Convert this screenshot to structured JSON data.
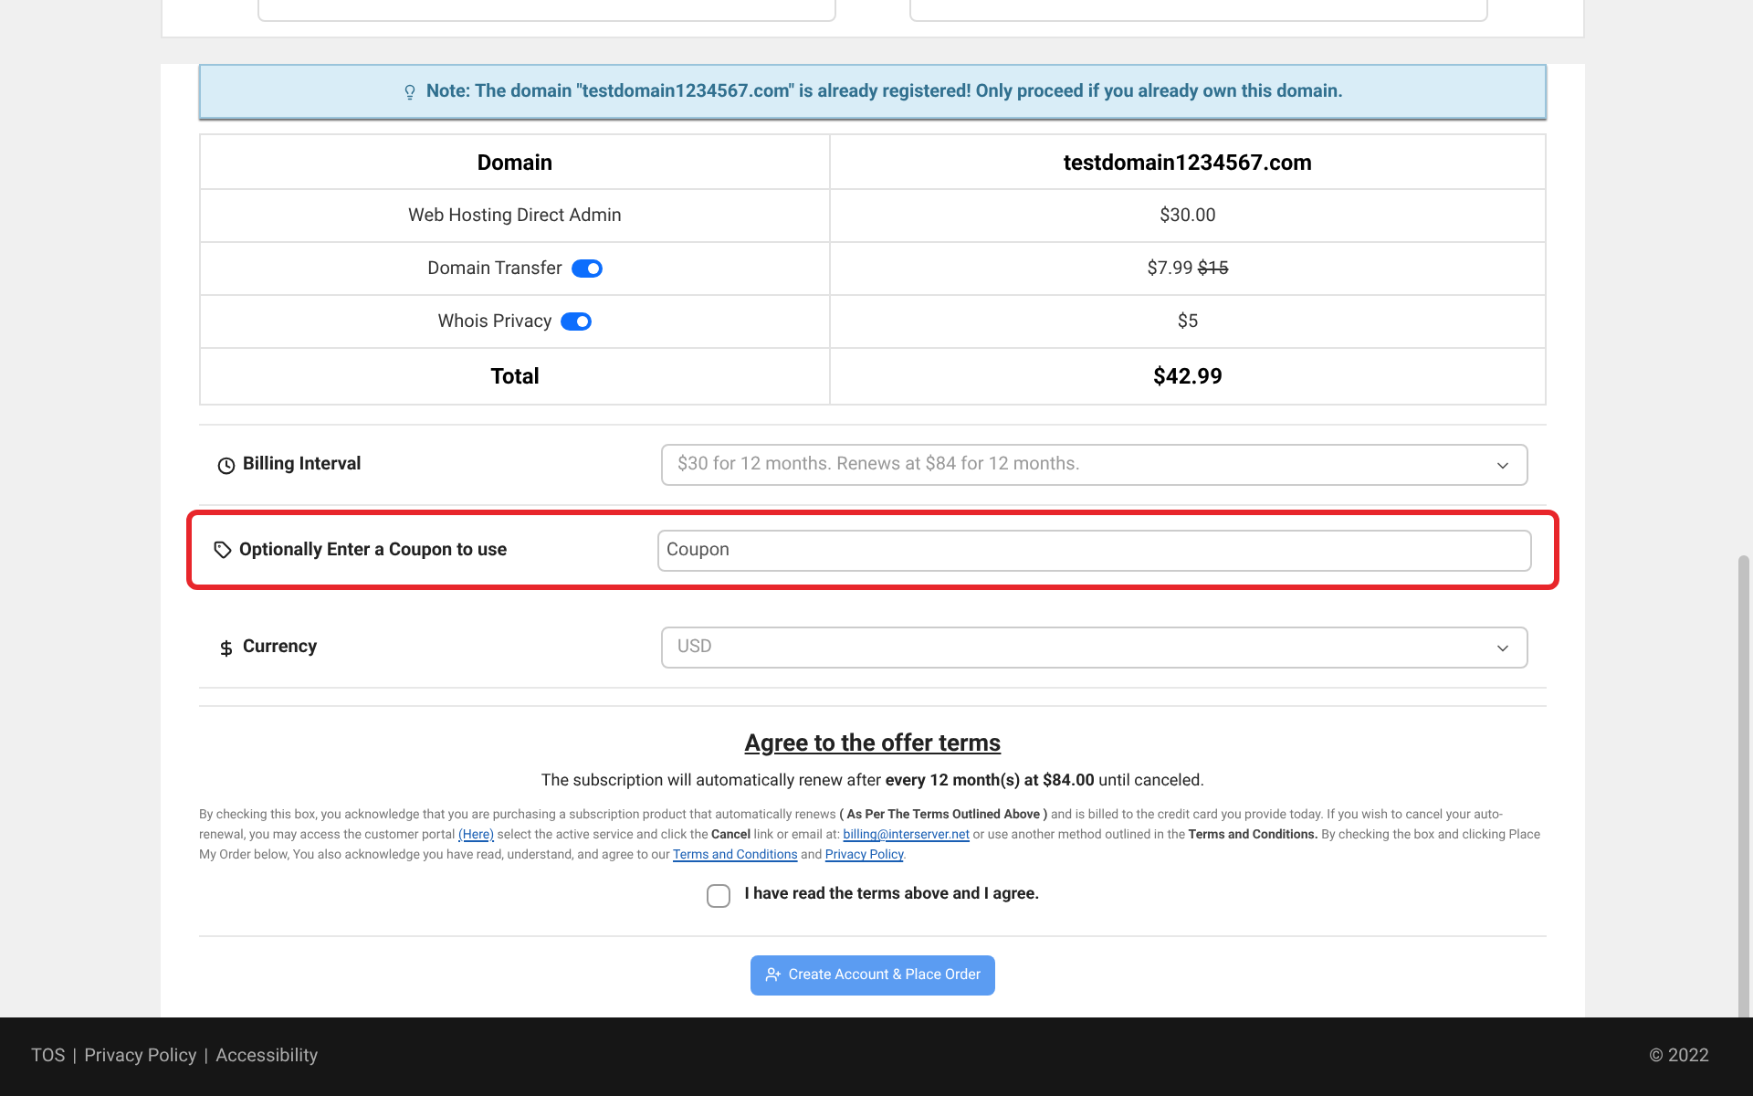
{
  "note": {
    "label": "Note:",
    "text": "The domain \"testdomain1234567.com\" is already registered! Only proceed if you already own this domain."
  },
  "summary": {
    "header": [
      "Domain",
      "testdomain1234567.com"
    ],
    "rows": [
      {
        "label": "Web Hosting Direct Admin",
        "price": "$30.00"
      },
      {
        "label": "Domain Transfer",
        "toggle": {
          "on": true
        },
        "price": "$7.99",
        "old_price": "$15"
      },
      {
        "label": "Whois Privacy",
        "toggle": {
          "on": true
        },
        "price": "$5"
      }
    ],
    "total": [
      "Total",
      "$42.99"
    ]
  },
  "options": [
    {
      "kind": "select",
      "label": "Billing Interval",
      "value": "$30 for 12 months. Renews at $84 for 12 months.",
      "highlighted": false
    },
    {
      "kind": "input",
      "label": "Optionally Enter a Coupon to use",
      "placeholder": "Coupon",
      "highlighted": true
    },
    {
      "kind": "select",
      "label": "Currency",
      "value": "USD",
      "highlighted": false
    }
  ],
  "terms": {
    "title": "Agree to the offer terms",
    "renewal": "The subscription will automatically renew after **every 12 month(s) at $84.00** until canceled.",
    "paragraph": [
      {
        "kind": "text",
        "text": "By checking this box, you acknowledge that you are purchasing a subscription product that automatically renews **( As Per The Terms Outlined Above )** and is billed to the credit card you provide today. If you wish to cancel your auto-renewal, you may access the customer portal "
      },
      {
        "kind": "link",
        "text": "(Here)"
      },
      {
        "kind": "text",
        "text": " select the active service and click the **Cancel** link or email at: "
      },
      {
        "kind": "link",
        "text": "billing@interserver.net"
      },
      {
        "kind": "text",
        "text": " or use another method outlined in the **Terms and Conditions.** By checking the box and clicking Place My Order below, You also acknowledge you have read, understand, and agree to our "
      },
      {
        "kind": "link",
        "text": "Terms and Conditions"
      },
      {
        "kind": "text",
        "text": " and "
      },
      {
        "kind": "link",
        "text": "Privacy Policy"
      },
      {
        "kind": "text",
        "text": "."
      }
    ],
    "agree": {
      "label": "I have read the terms above and I agree.",
      "checked": false
    }
  },
  "submit": "Create Account & Place Order",
  "footer": {
    "separator": "|",
    "links": [
      "TOS",
      "Privacy Policy",
      "Accessibility"
    ],
    "copyright": "© 2022"
  }
}
